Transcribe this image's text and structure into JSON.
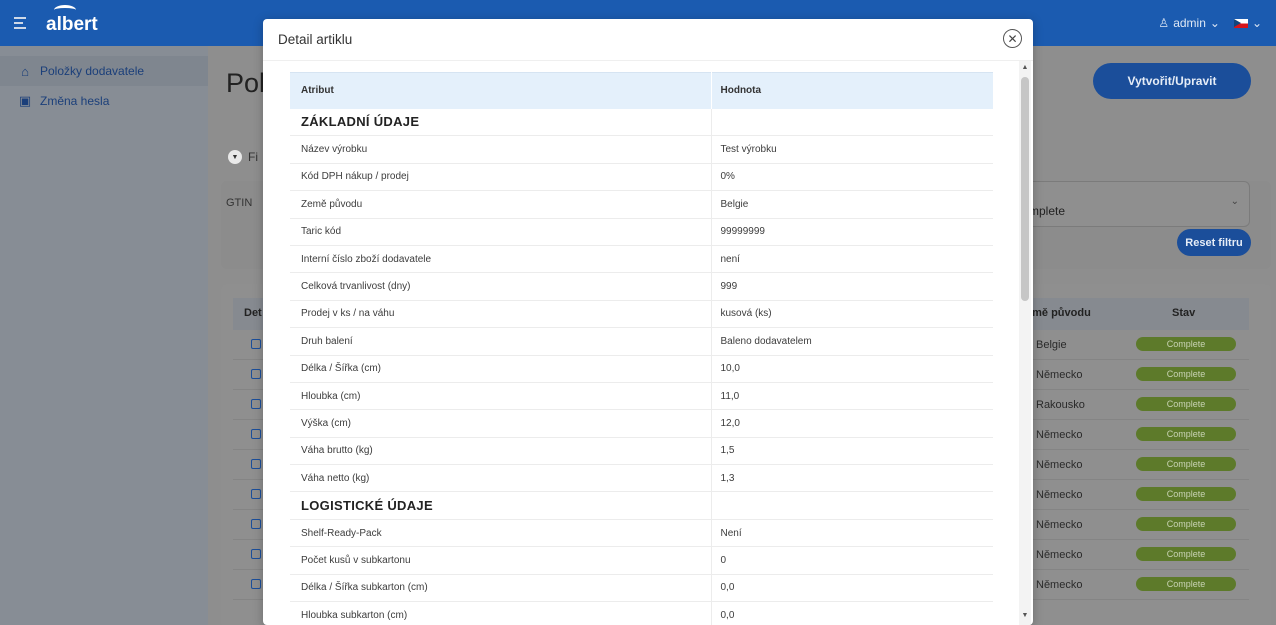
{
  "header": {
    "logo": "albert",
    "user": "admin"
  },
  "sidebar": {
    "items": [
      {
        "label": "Položky dodavatele",
        "icon": "home-icon"
      },
      {
        "label": "Změna hesla",
        "icon": "key-box-icon"
      }
    ]
  },
  "background": {
    "page_title_partial": "Polo",
    "create_button": "Vytvořit/Upravit",
    "filters_partial": "Fi",
    "gtin_partial": "GTIN",
    "state_select_partial": "mplete",
    "reset_button": "Reset filtru",
    "table_header_partial": "Det",
    "table_header_country_partial": "emě původu",
    "table_header_status": "Stav",
    "rows": [
      {
        "country": "Belgie",
        "status": "Complete"
      },
      {
        "country": "Německo",
        "status": "Complete"
      },
      {
        "country": "Rakousko",
        "status": "Complete"
      },
      {
        "country": "Německo",
        "status": "Complete"
      },
      {
        "country": "Německo",
        "status": "Complete"
      },
      {
        "country": "Německo",
        "status": "Complete"
      },
      {
        "country": "Německo",
        "status": "Complete"
      },
      {
        "country": "Německo",
        "status": "Complete"
      },
      {
        "country": "Německo",
        "status": "Complete"
      }
    ]
  },
  "modal": {
    "title": "Detail artiklu",
    "col_attr": "Atribut",
    "col_value": "Hodnota",
    "rows": [
      {
        "attr": "ZÁKLADNÍ ÚDAJE",
        "value": "",
        "section": true
      },
      {
        "attr": "Název výrobku",
        "value": "Test výrobku"
      },
      {
        "attr": "Kód DPH nákup / prodej",
        "value": "0%"
      },
      {
        "attr": "Země původu",
        "value": "Belgie"
      },
      {
        "attr": "Taric kód",
        "value": "99999999"
      },
      {
        "attr": "Interní číslo zboží dodavatele",
        "value": "není"
      },
      {
        "attr": "Celková trvanlivost (dny)",
        "value": "999"
      },
      {
        "attr": "Prodej v ks / na váhu",
        "value": "kusová (ks)"
      },
      {
        "attr": "Druh balení",
        "value": "Baleno dodavatelem"
      },
      {
        "attr": "Délka / Šířka (cm)",
        "value": "10,0"
      },
      {
        "attr": "Hloubka (cm)",
        "value": "11,0"
      },
      {
        "attr": "Výška (cm)",
        "value": "12,0"
      },
      {
        "attr": "Váha brutto (kg)",
        "value": "1,5"
      },
      {
        "attr": "Váha netto (kg)",
        "value": "1,3"
      },
      {
        "attr": "LOGISTICKÉ ÚDAJE",
        "value": "",
        "section": true
      },
      {
        "attr": "Shelf-Ready-Pack",
        "value": "Není"
      },
      {
        "attr": "Počet kusů v subkartonu",
        "value": "0"
      },
      {
        "attr": "Délka / Šířka subkarton (cm)",
        "value": "0,0"
      },
      {
        "attr": "Hloubka subkarton (cm)",
        "value": "0,0"
      }
    ]
  }
}
